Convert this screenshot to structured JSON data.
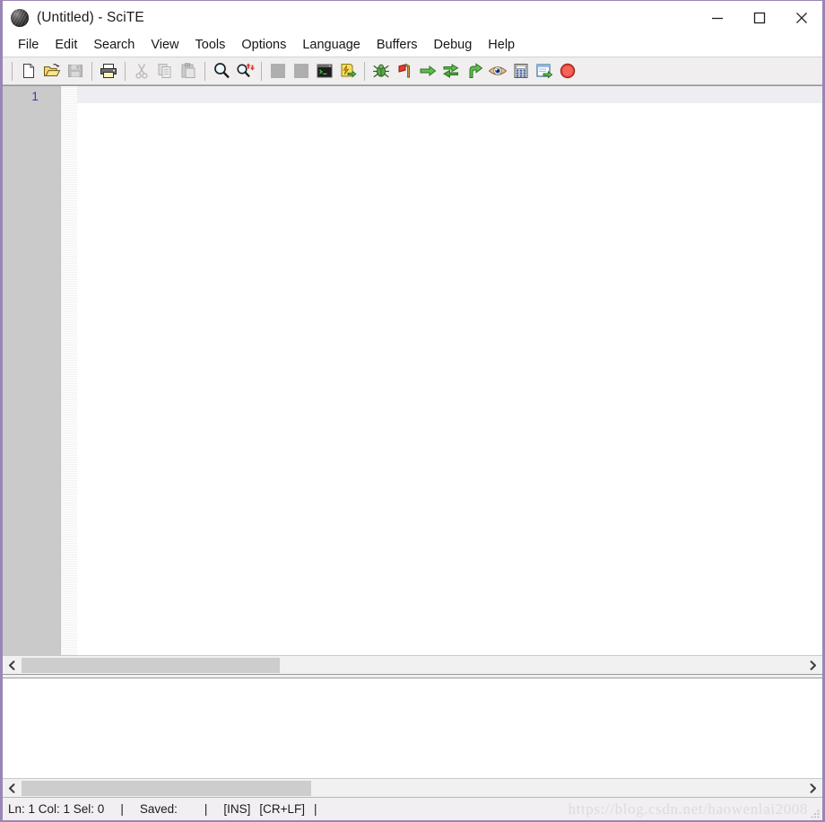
{
  "window": {
    "title": "(Untitled) - SciTE",
    "icon": "scite-ball-icon",
    "border_color": "#9a86b4",
    "controls": {
      "minimize": "Minimize",
      "maximize": "Maximize",
      "close": "Close"
    }
  },
  "menu": {
    "items": [
      {
        "label": "File"
      },
      {
        "label": "Edit"
      },
      {
        "label": "Search"
      },
      {
        "label": "View"
      },
      {
        "label": "Tools"
      },
      {
        "label": "Options"
      },
      {
        "label": "Language"
      },
      {
        "label": "Buffers"
      },
      {
        "label": "Debug"
      },
      {
        "label": "Help"
      }
    ]
  },
  "toolbar": {
    "groups": [
      {
        "buttons": [
          {
            "name": "new-file-icon",
            "title": "New",
            "enabled": true
          },
          {
            "name": "open-file-icon",
            "title": "Open",
            "enabled": true
          },
          {
            "name": "save-file-icon",
            "title": "Save",
            "enabled": false
          }
        ]
      },
      {
        "buttons": [
          {
            "name": "print-icon",
            "title": "Print",
            "enabled": true
          }
        ]
      },
      {
        "buttons": [
          {
            "name": "cut-icon",
            "title": "Cut",
            "enabled": false
          },
          {
            "name": "copy-icon",
            "title": "Copy",
            "enabled": false
          },
          {
            "name": "paste-icon",
            "title": "Paste",
            "enabled": false
          }
        ]
      },
      {
        "buttons": [
          {
            "name": "find-icon",
            "title": "Find",
            "enabled": true
          },
          {
            "name": "find-replace-icon",
            "title": "Replace",
            "enabled": true
          }
        ]
      },
      {
        "buttons": [
          {
            "name": "undo-icon",
            "title": "Undo",
            "enabled": false
          },
          {
            "name": "redo-icon",
            "title": "Redo",
            "enabled": false
          },
          {
            "name": "console-icon",
            "title": "Console",
            "enabled": true
          },
          {
            "name": "compile-icon",
            "title": "Compile",
            "enabled": true
          }
        ]
      },
      {
        "buttons": [
          {
            "name": "debug-bug-icon",
            "title": "Debug",
            "enabled": true
          },
          {
            "name": "breakpoint-flag-icon",
            "title": "Breakpoint",
            "enabled": true
          },
          {
            "name": "step-into-arrow-icon",
            "title": "Step Into",
            "enabled": true
          },
          {
            "name": "step-over-icon",
            "title": "Step Over",
            "enabled": true
          },
          {
            "name": "step-out-icon",
            "title": "Step Out",
            "enabled": true
          },
          {
            "name": "watch-eye-icon",
            "title": "Watch",
            "enabled": true
          },
          {
            "name": "calculator-icon",
            "title": "Evaluate",
            "enabled": true
          },
          {
            "name": "run-window-icon",
            "title": "Go",
            "enabled": true
          },
          {
            "name": "stop-icon",
            "title": "Stop",
            "enabled": true
          }
        ]
      }
    ]
  },
  "editor": {
    "line_numbers": [
      "1"
    ],
    "content": "",
    "gutter_bg": "#cacaca",
    "line_number_color": "#3b3bb0",
    "current_line_bg": "#eeedf2"
  },
  "scrollbars": {
    "editor_h": {
      "left_arrow": "‹",
      "right_arrow": "›",
      "thumb_left_pct": 0,
      "thumb_width_pct": 33
    },
    "output_h": {
      "left_arrow": "‹",
      "right_arrow": "›",
      "thumb_left_pct": 0,
      "thumb_width_pct": 37
    }
  },
  "output": {
    "content": ""
  },
  "status": {
    "position": "Ln: 1 Col: 1 Sel: 0",
    "sep1": "|",
    "saved": "Saved:",
    "sep2": "|",
    "insert_mode": "[INS]",
    "eol_mode": "[CR+LF]",
    "sep3": "|"
  },
  "watermark": {
    "text": "https://blog.csdn.net/haowenlai2008"
  }
}
